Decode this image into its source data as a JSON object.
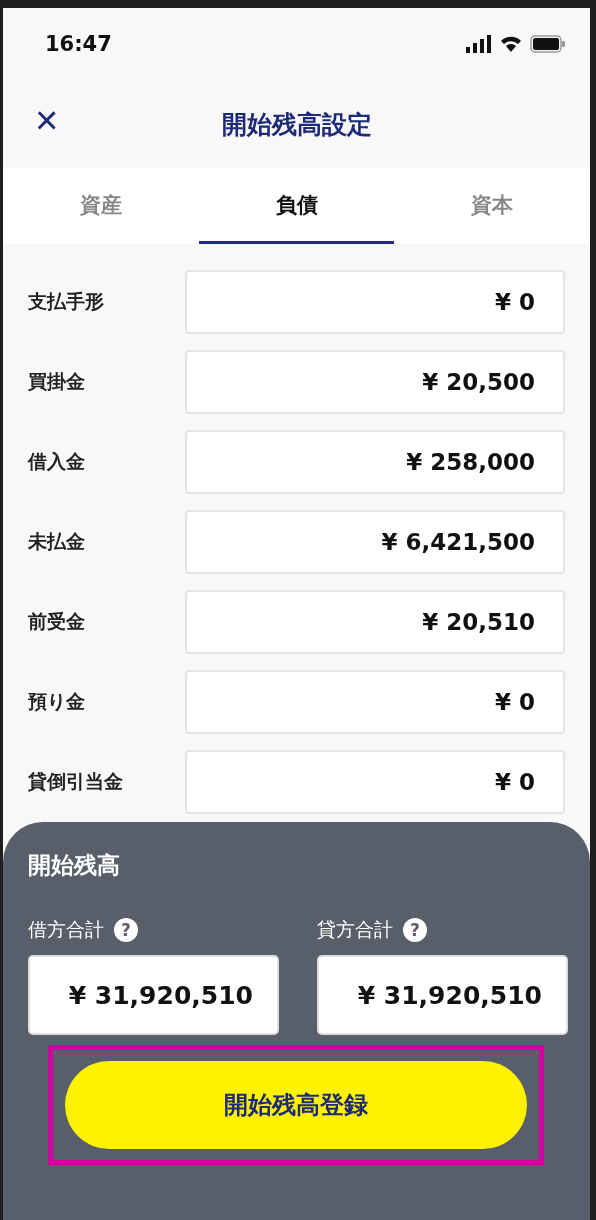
{
  "status_bar": {
    "time": "16:47"
  },
  "header": {
    "close": "×",
    "title": "開始残高設定"
  },
  "tabs": [
    {
      "label": "資産",
      "selected": false
    },
    {
      "label": "負債",
      "selected": true
    },
    {
      "label": "資本",
      "selected": false
    }
  ],
  "rows": [
    {
      "label": "支払手形",
      "value": "¥ 0"
    },
    {
      "label": "買掛金",
      "value": "¥ 20,500"
    },
    {
      "label": "借入金",
      "value": "¥ 258,000"
    },
    {
      "label": "未払金",
      "value": "¥ 6,421,500"
    },
    {
      "label": "前受金",
      "value": "¥ 20,510"
    },
    {
      "label": "預り金",
      "value": "¥ 0"
    },
    {
      "label": "貸倒引当金",
      "value": "¥ 0"
    }
  ],
  "summary": {
    "title": "開始残高",
    "totals": [
      {
        "label": "借方合計",
        "help": "?",
        "value": "¥ 31,920,510"
      },
      {
        "label": "貸方合計",
        "help": "?",
        "value": "¥ 31,920,510"
      }
    ],
    "button": {
      "label": "開始残高登録",
      "highlighted": true
    }
  }
}
